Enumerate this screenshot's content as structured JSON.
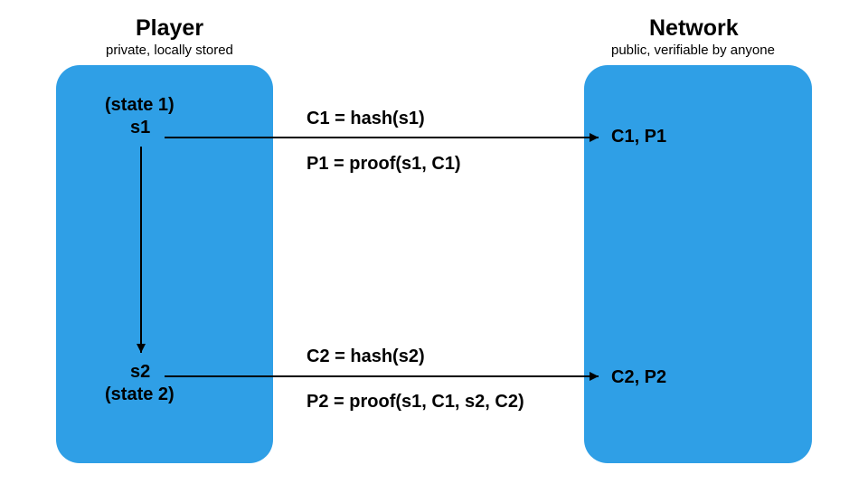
{
  "player": {
    "title": "Player",
    "subtitle": "private, locally stored",
    "state1_label": "(state 1)",
    "s1": "s1",
    "s2": "s2",
    "state2_label": "(state 2)"
  },
  "network": {
    "title": "Network",
    "subtitle": "public, verifiable by anyone",
    "row1": "C1, P1",
    "row2": "C2, P2"
  },
  "arrows": {
    "arrow1_eq1": "C1 = hash(s1)",
    "arrow1_eq2": "P1 = proof(s1, C1)",
    "arrow2_eq1": "C2 = hash(s2)",
    "arrow2_eq2": "P2 = proof(s1, C1, s2, C2)"
  },
  "colors": {
    "panel": "#2f9fe6",
    "text": "#000000"
  }
}
